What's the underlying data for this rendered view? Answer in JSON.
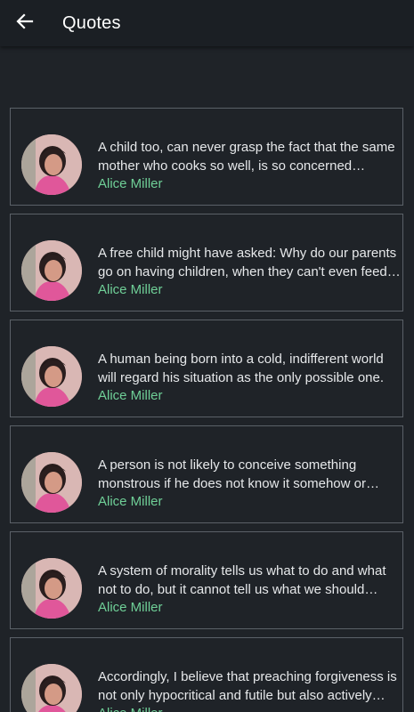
{
  "appbar": {
    "title": "Quotes",
    "back_icon": "arrow-left-icon"
  },
  "colors": {
    "background": "#1f2328",
    "appbar": "#1b1f24",
    "card_border": "#5b6168",
    "quote_text": "#e6e8ea",
    "author_text": "#6fcf97"
  },
  "quotes": [
    {
      "text": "A child too, can never grasp the fact that the same mother who cooks so well, is so concerned about…",
      "author": "Alice Miller"
    },
    {
      "text": "A free child might have asked: Why do our parents go on having children, when they can't even feed…",
      "author": "Alice Miller"
    },
    {
      "text": "A human being born into a cold, indifferent world will regard his situation as the only possible one.",
      "author": "Alice Miller"
    },
    {
      "text": "A person is not likely to conceive something monstrous if he does not know it somehow or…",
      "author": "Alice Miller"
    },
    {
      "text": "A system of morality tells us what to do and what not to do, but it cannot tell us what we should feel…",
      "author": "Alice Miller"
    },
    {
      "text": "Accordingly, I believe that preaching forgiveness is not only hypocritical and futile but also actively…",
      "author": "Alice Miller"
    }
  ]
}
